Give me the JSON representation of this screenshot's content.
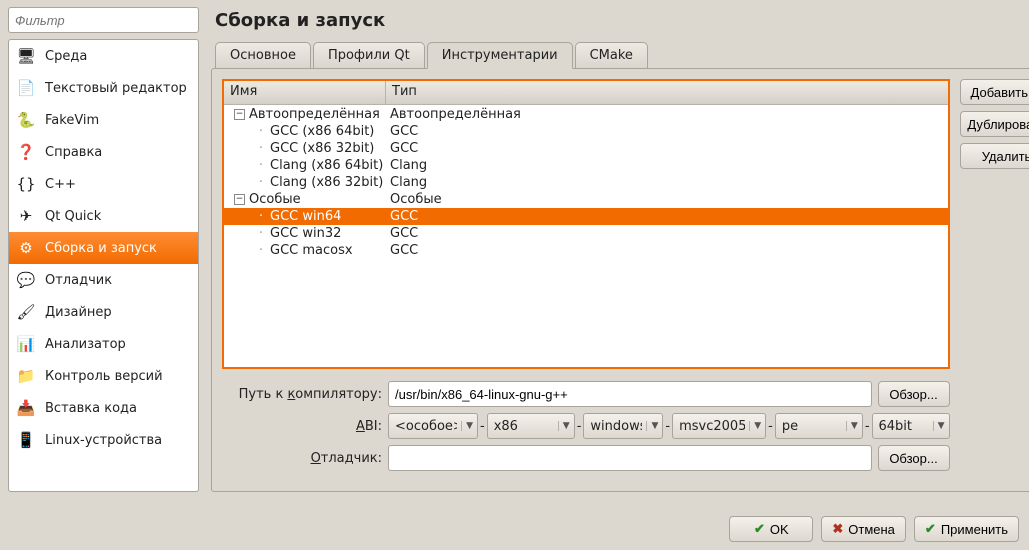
{
  "filter_placeholder": "Фильтр",
  "page_title": "Сборка и запуск",
  "sidebar": {
    "items": [
      {
        "label": "Среда"
      },
      {
        "label": "Текстовый редактор"
      },
      {
        "label": "FakeVim"
      },
      {
        "label": "Справка"
      },
      {
        "label": "C++"
      },
      {
        "label": "Qt Quick"
      },
      {
        "label": "Сборка и запуск"
      },
      {
        "label": "Отладчик"
      },
      {
        "label": "Дизайнер"
      },
      {
        "label": "Анализатор"
      },
      {
        "label": "Контроль версий"
      },
      {
        "label": "Вставка кода"
      },
      {
        "label": "Linux-устройства"
      }
    ],
    "selected_index": 6
  },
  "tabs": [
    {
      "label": "Основное"
    },
    {
      "label": "Профили Qt"
    },
    {
      "label": "Инструментарии"
    },
    {
      "label": "CMake"
    }
  ],
  "active_tab_index": 2,
  "tree": {
    "headers": {
      "name": "Имя",
      "type": "Тип"
    },
    "rows": [
      {
        "depth": 0,
        "expander": "-",
        "name": "Автоопределённая",
        "type": "Автоопределённая"
      },
      {
        "depth": 1,
        "name": "GCC (x86 64bit)",
        "type": "GCC"
      },
      {
        "depth": 1,
        "name": "GCC (x86 32bit)",
        "type": "GCC"
      },
      {
        "depth": 1,
        "name": "Clang (x86 64bit)",
        "type": "Clang"
      },
      {
        "depth": 1,
        "name": "Clang (x86 32bit)",
        "type": "Clang"
      },
      {
        "depth": 0,
        "expander": "-",
        "name": "Особые",
        "type": "Особые"
      },
      {
        "depth": 1,
        "name": "GCC win64",
        "type": "GCC",
        "selected": true
      },
      {
        "depth": 1,
        "name": "GCC win32",
        "type": "GCC"
      },
      {
        "depth": 1,
        "name": "GCC macosx",
        "type": "GCC"
      }
    ]
  },
  "side_buttons": {
    "add": "Добавить",
    "clone": "Дублировать",
    "delete": "Удалить"
  },
  "form": {
    "compiler_path_label": "Путь к компилятору:",
    "compiler_path_value": "/usr/bin/x86_64-linux-gnu-g++",
    "abi_label": "ABI:",
    "abi_values": [
      "<особое>",
      "x86",
      "windows",
      "msvc2005",
      "pe",
      "64bit"
    ],
    "debugger_label": "Отладчик:",
    "debugger_value": "",
    "browse": "Обзор..."
  },
  "dialog_buttons": {
    "ok": "OK",
    "cancel": "Отмена",
    "apply": "Применить"
  }
}
